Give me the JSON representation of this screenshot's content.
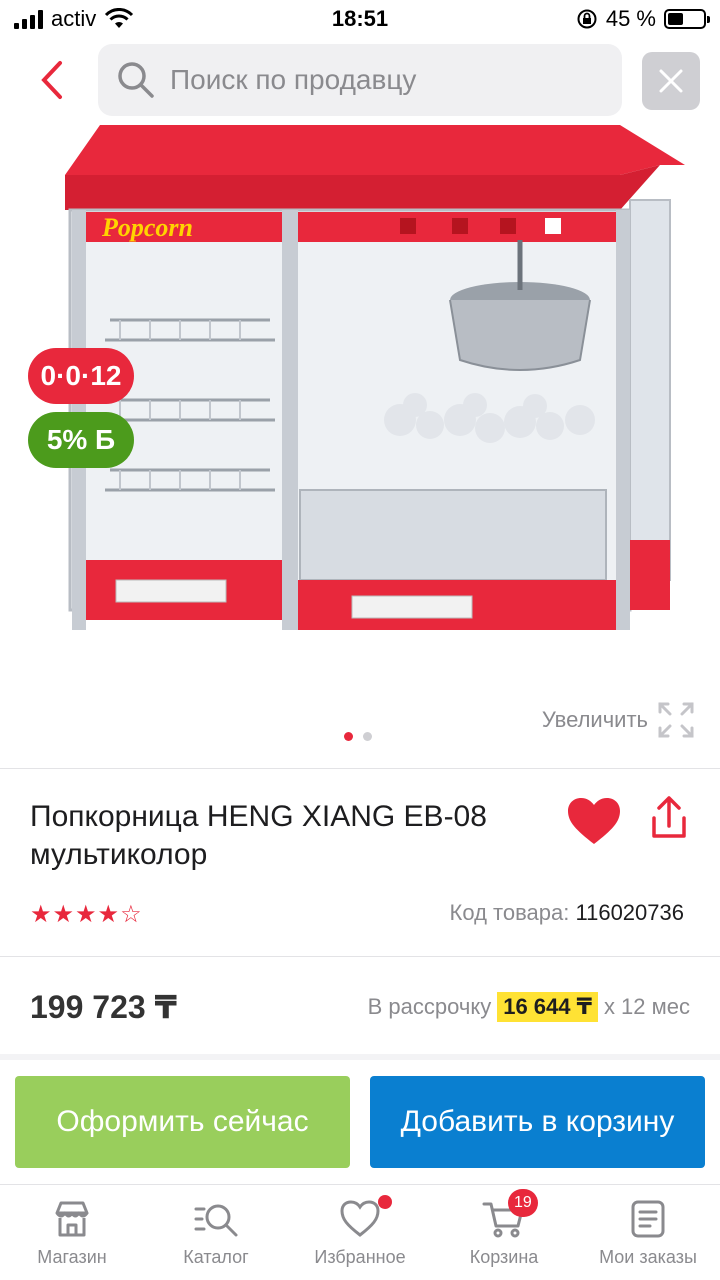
{
  "status_bar": {
    "carrier": "activ",
    "time": "18:51",
    "battery": "45 %",
    "battery_level": 0.45
  },
  "search": {
    "placeholder": "Поиск по продавцу"
  },
  "badges": {
    "installment": "0·0·12",
    "bonus": "5% Б"
  },
  "zoom_label": "Увеличить",
  "carousel": {
    "current": 1,
    "total": 2
  },
  "product": {
    "title": "Попкорница HENG XIANG EB-08 мультиколор",
    "rating": 4,
    "rating_max": 5,
    "sku_label": "Код товара:",
    "sku": "116020736",
    "price": "199 723 ₸",
    "installment_prefix": "В рассрочку",
    "installment_amount": "16 644 ₸",
    "installment_suffix": "х 12 мес"
  },
  "buttons": {
    "buy_now": "Оформить сейчас",
    "add_to_cart": "Добавить в корзину"
  },
  "colors": {
    "accent_red": "#e8283c",
    "buy_green": "#99ce5c",
    "cart_blue": "#0a7fd0",
    "highlight": "#ffe234"
  },
  "tabbar": {
    "items": [
      {
        "label": "Магазин",
        "icon": "shop-icon"
      },
      {
        "label": "Каталог",
        "icon": "catalog-search-icon"
      },
      {
        "label": "Избранное",
        "icon": "heart-outline-icon"
      },
      {
        "label": "Корзина",
        "icon": "cart-icon",
        "badge": "19"
      },
      {
        "label": "Мои заказы",
        "icon": "orders-icon"
      }
    ]
  }
}
